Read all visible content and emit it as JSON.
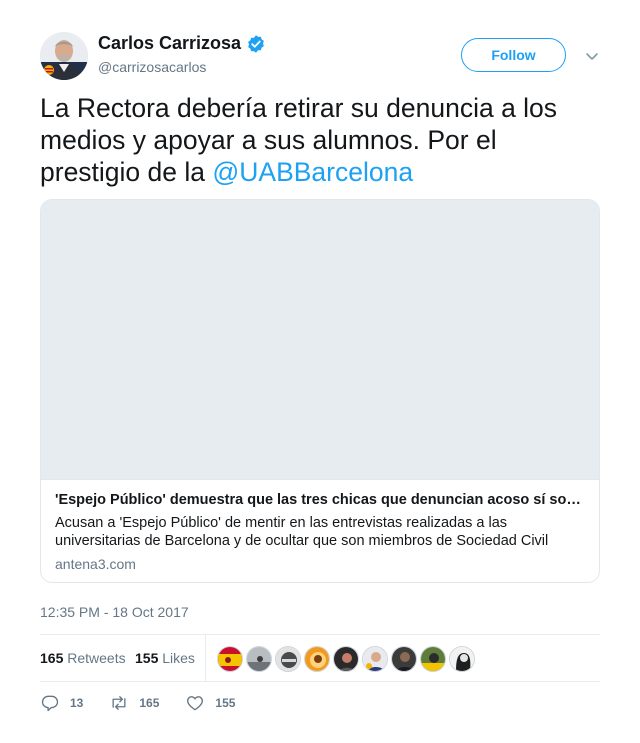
{
  "author": {
    "display_name": "Carlos Carrizosa",
    "handle": "@carrizosacarlos",
    "avatar": "profile-photo",
    "verified": true
  },
  "follow_label": "Follow",
  "tweet": {
    "text_before_mention": "La Rectora debería retirar su denuncia a los medios y apoyar a sus alumnos. Por el prestigio de la ",
    "mention": "@UABBarcelona"
  },
  "card": {
    "title": "'Espejo Público' demuestra que las tres chicas que denuncian acoso sí son e…",
    "description": "Acusan a 'Espejo Público' de mentir en las entrevistas realizadas a las universitarias de Barcelona y de ocultar que son miembros de Sociedad Civil Catalana. El",
    "domain": "antena3.com"
  },
  "timestamp": "12:35 PM - 18 Oct 2017",
  "stats": {
    "retweets_count": "165",
    "retweets_label": "Retweets",
    "likes_count": "155",
    "likes_label": "Likes"
  },
  "likers": [
    "spain-flag-avatar",
    "grey-landscape-avatar",
    "helmet-avatar",
    "orange-ring-avatar",
    "dark-portrait-avatar",
    "suit-man-avatar",
    "dark-man-avatar",
    "flag-crest-avatar",
    "bw-woman-avatar"
  ],
  "actions": {
    "replies": "13",
    "retweets": "165",
    "likes": "155"
  },
  "colors": {
    "accent": "#1da1f2",
    "text": "#14171a",
    "muted": "#657786",
    "border": "#e1e8ed"
  }
}
